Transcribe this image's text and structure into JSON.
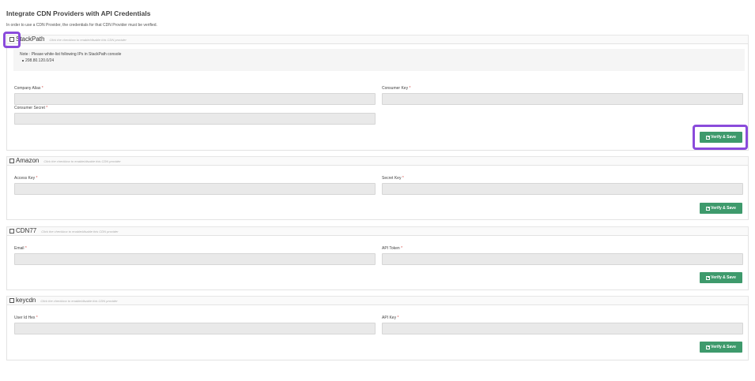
{
  "page": {
    "heading": "Integrate CDN Providers with API Credentials",
    "subtext": "In order to use a CDN Provider, the credentials for that CDN Provider must be verified."
  },
  "providers": [
    {
      "name": "StackPath",
      "hint": "Click the checkbox to enable/disable this CDN provider",
      "note_title": "Note : Please white-list following IPs in StackPath console",
      "note_ip": "208.80.120.0/24",
      "fields": [
        {
          "label": "Company Alias",
          "required": "*",
          "value": ""
        },
        {
          "label": "Consumer Key",
          "required": "*",
          "value": ""
        },
        {
          "label": "Consumer Secret",
          "required": "*",
          "value": ""
        }
      ],
      "button": "Verify & Save"
    },
    {
      "name": "Amazon",
      "hint": "Click the checkbox to enable/disable this CDN provider",
      "fields": [
        {
          "label": "Access Key",
          "required": "*",
          "value": ""
        },
        {
          "label": "Secret Key",
          "required": "*",
          "value": ""
        }
      ],
      "button": "Verify & Save"
    },
    {
      "name": "CDN77",
      "hint": "Click the checkbox to enable/disable this CDN provider",
      "fields": [
        {
          "label": "Email",
          "required": "*",
          "value": ""
        },
        {
          "label": "API Token",
          "required": "*",
          "value": ""
        }
      ],
      "button": "Verify & Save"
    },
    {
      "name": "keycdn",
      "hint": "Click the checkbox to enable/disable this CDN provider",
      "fields": [
        {
          "label": "User Id Hex",
          "required": "*",
          "value": ""
        },
        {
          "label": "API Key",
          "required": "*",
          "value": ""
        }
      ],
      "button": "Verify & Save"
    }
  ],
  "icons": {
    "checkbox": "checkbox-unchecked-icon",
    "save": "floppy-disk-icon"
  },
  "colors": {
    "button": "#3e9a6c",
    "required": "#d9534f",
    "highlight": "#8a4bdb"
  }
}
